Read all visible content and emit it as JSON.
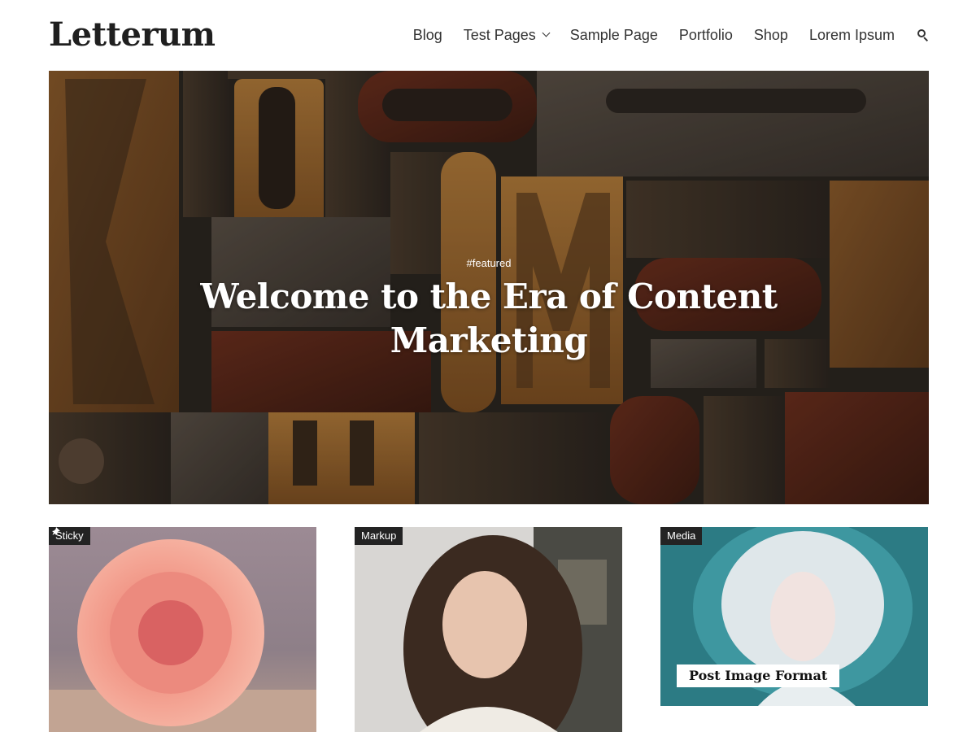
{
  "site": {
    "title": "Letterum"
  },
  "nav": {
    "items": [
      {
        "label": "Blog"
      },
      {
        "label": "Test Pages"
      },
      {
        "label": "Sample Page"
      },
      {
        "label": "Portfolio"
      },
      {
        "label": "Shop"
      },
      {
        "label": "Lorem Ipsum"
      }
    ],
    "search_icon": "search-icon"
  },
  "hero": {
    "tag": "#featured",
    "title": "Welcome to the Era of Content Marketing"
  },
  "cards": [
    {
      "label": "Sticky",
      "badge_icon": "pin-icon",
      "title": ""
    },
    {
      "label": "Markup",
      "title": ""
    },
    {
      "label": "Media",
      "title": "Post Image Format"
    }
  ],
  "colors": {
    "label_bg": "#232323",
    "text": "#333333",
    "hero_text": "#ffffff"
  }
}
